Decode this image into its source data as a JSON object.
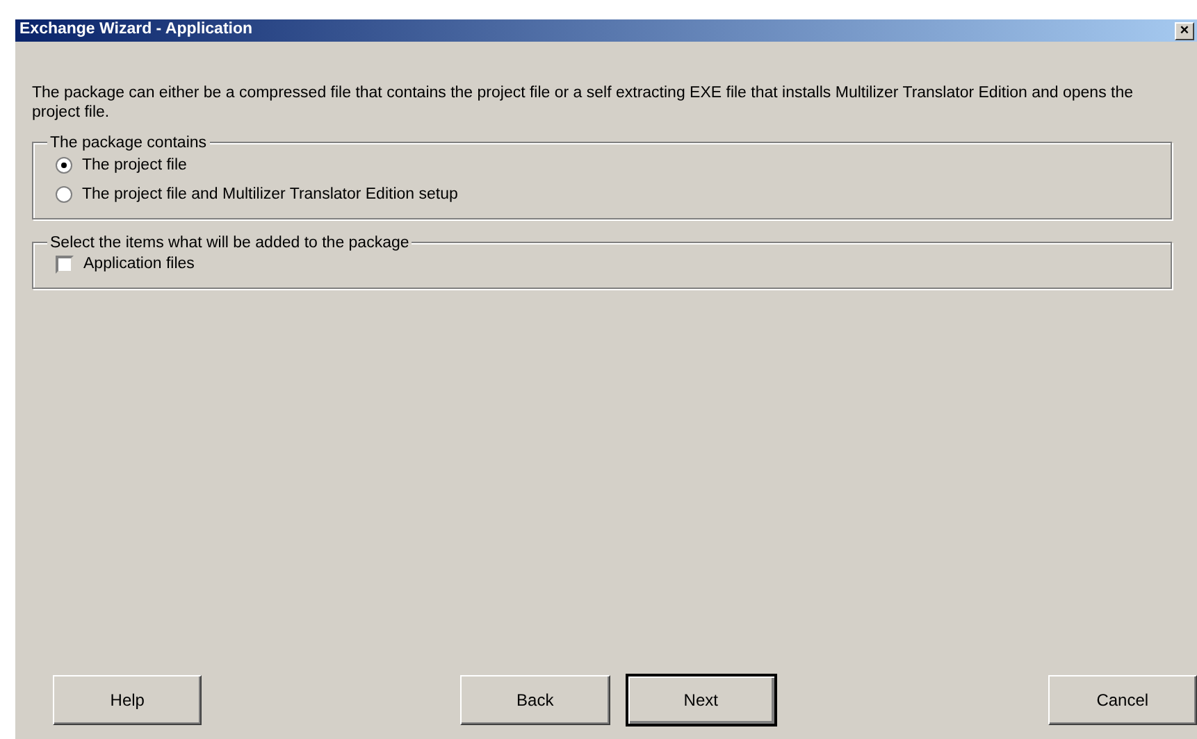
{
  "window": {
    "title": "Exchange Wizard - Application",
    "close": "×"
  },
  "description": "The package can either be a compressed file that contains the project file or a self extracting EXE file that installs Multilizer Translator Edition and opens the project file.",
  "package_group": {
    "title": "The package contains",
    "options": [
      {
        "label": "The project file",
        "selected": true
      },
      {
        "label": "The project file and Multilizer Translator Edition setup",
        "selected": false
      }
    ]
  },
  "items_group": {
    "title": "Select the items what will be added to the package",
    "items": [
      {
        "label": "Application files",
        "checked": false
      }
    ]
  },
  "buttons": [
    {
      "label": "Help",
      "default": false
    },
    {
      "label": "Back",
      "default": false
    },
    {
      "label": "Next",
      "default": true
    },
    {
      "label": "Cancel",
      "default": false
    }
  ]
}
